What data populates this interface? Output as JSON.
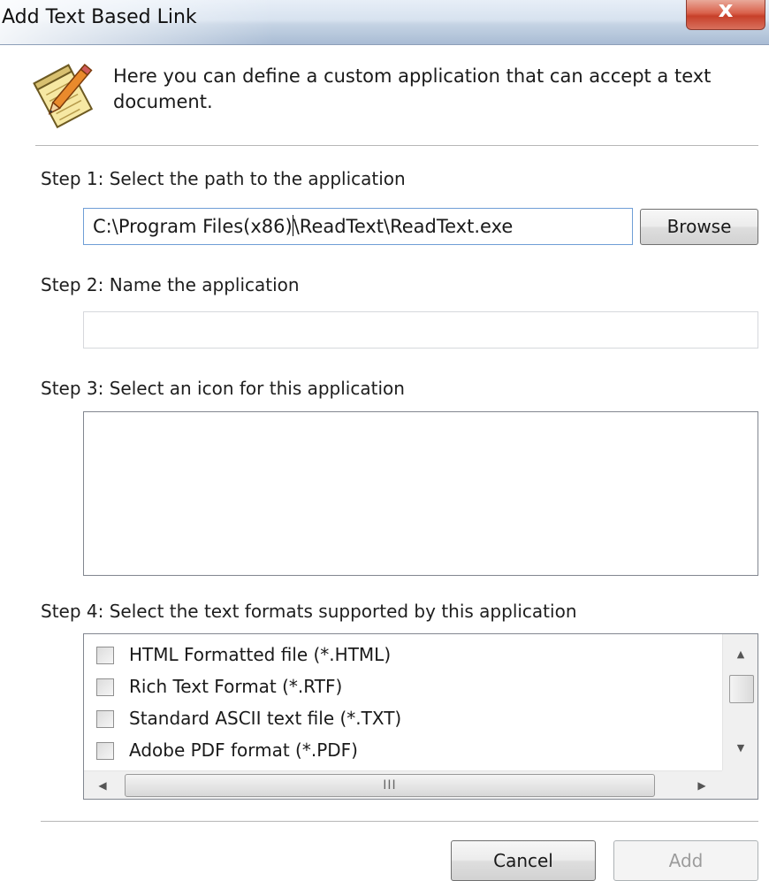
{
  "window": {
    "title": "Add Text Based Link",
    "close_symbol": "x"
  },
  "intro": {
    "icon": "notepad-pencil-icon",
    "text": "Here you can define a custom application that can accept a text document."
  },
  "step1": {
    "label": "Step 1: Select the path to the application",
    "path_before_caret": "C:\\Program Files(x86)",
    "path_after_caret": "\\ReadText\\ReadText.exe",
    "browse_label": "Browse"
  },
  "step2": {
    "label": "Step 2: Name the application",
    "value": ""
  },
  "step3": {
    "label": "Step 3: Select an icon for this application"
  },
  "step4": {
    "label": "Step 4: Select the text formats supported by this application",
    "formats": [
      {
        "label": "HTML Formatted file (*.HTML)",
        "checked": false
      },
      {
        "label": "Rich Text Format (*.RTF)",
        "checked": false
      },
      {
        "label": "Standard ASCII text file (*.TXT)",
        "checked": false
      },
      {
        "label": "Adobe PDF format (*.PDF)",
        "checked": false
      }
    ],
    "hscroll_grip": "III"
  },
  "footer": {
    "cancel_label": "Cancel",
    "add_label": "Add"
  }
}
